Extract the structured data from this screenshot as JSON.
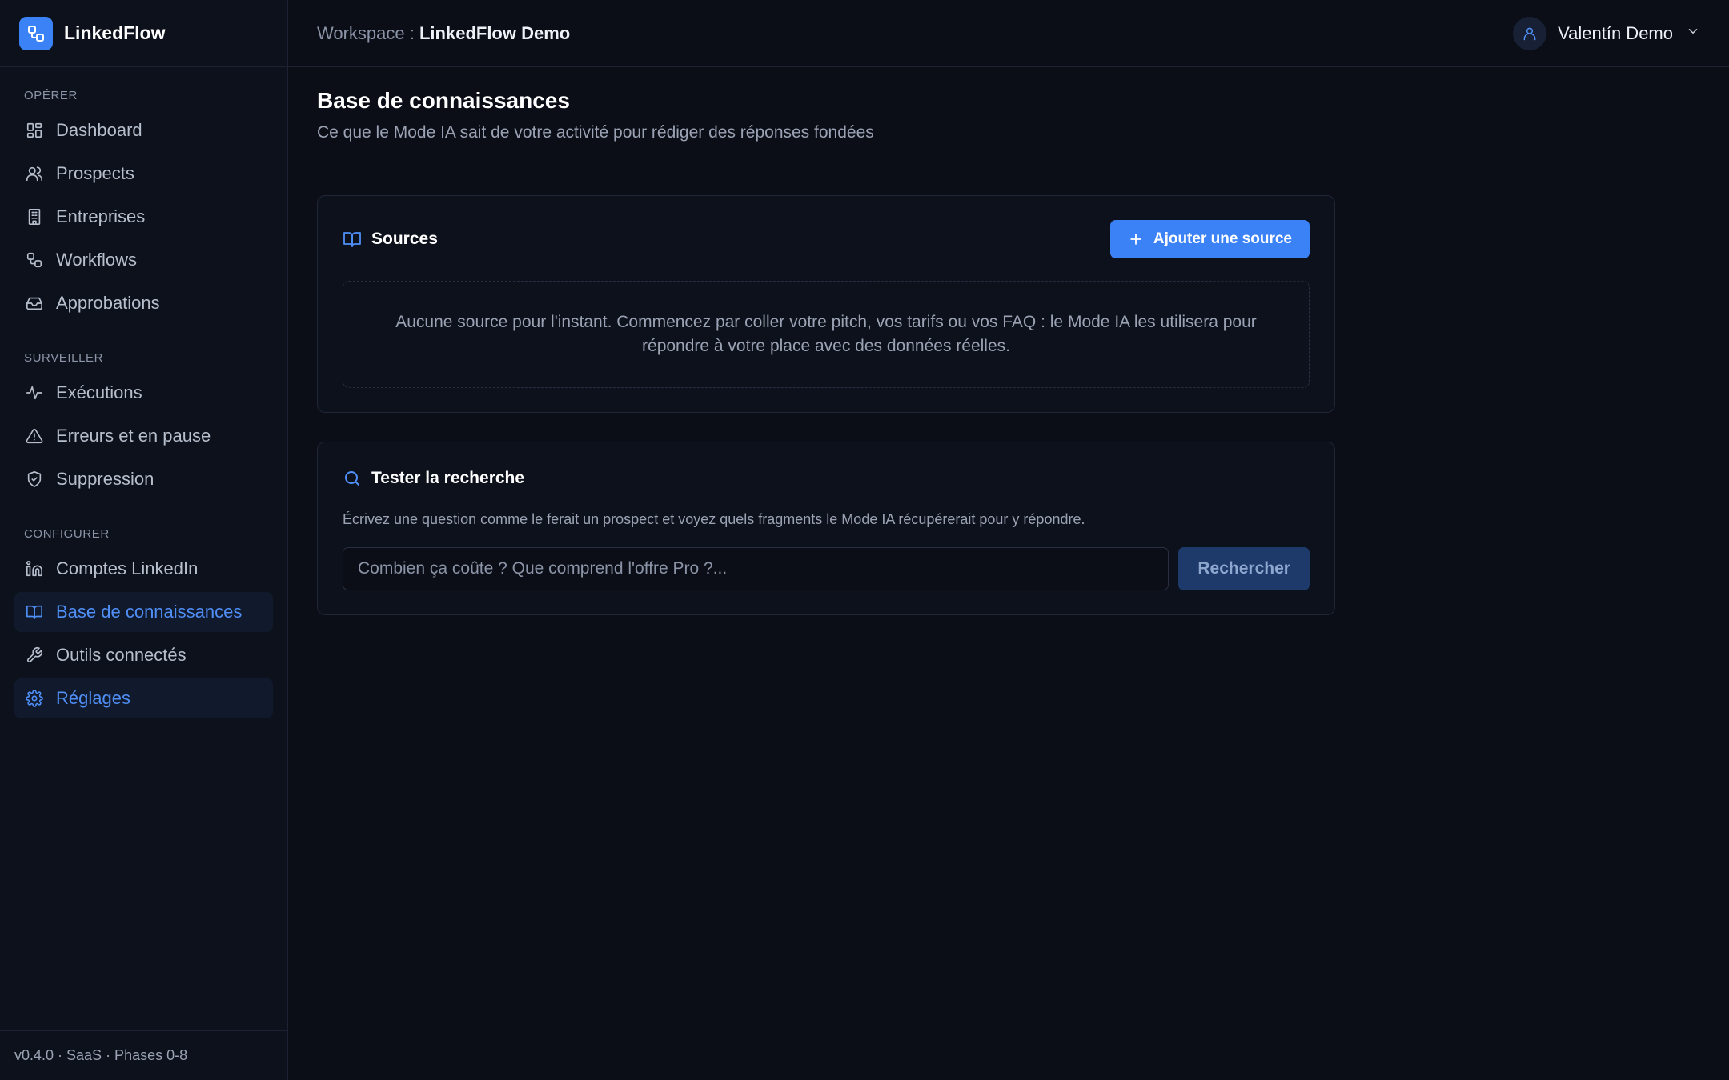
{
  "brand": {
    "name": "LinkedFlow",
    "icon": "workflow-icon",
    "accent": "#3b82f6"
  },
  "sidebar": {
    "sections": [
      {
        "title": "OPÉRER",
        "items": [
          {
            "label": "Dashboard",
            "icon": "dashboard-icon",
            "active": false
          },
          {
            "label": "Prospects",
            "icon": "users-icon",
            "active": false
          },
          {
            "label": "Entreprises",
            "icon": "building-icon",
            "active": false
          },
          {
            "label": "Workflows",
            "icon": "workflow-icon",
            "active": false
          },
          {
            "label": "Approbations",
            "icon": "inbox-icon",
            "active": false
          }
        ]
      },
      {
        "title": "SURVEILLER",
        "items": [
          {
            "label": "Exécutions",
            "icon": "activity-icon",
            "active": false
          },
          {
            "label": "Erreurs et en pause",
            "icon": "warning-icon",
            "active": false
          },
          {
            "label": "Suppression",
            "icon": "shield-icon",
            "active": false
          }
        ]
      },
      {
        "title": "CONFIGURER",
        "items": [
          {
            "label": "Comptes LinkedIn",
            "icon": "linkedin-icon",
            "active": false
          },
          {
            "label": "Base de connaissances",
            "icon": "book-icon",
            "active": true
          },
          {
            "label": "Outils connectés",
            "icon": "wrench-icon",
            "active": false
          },
          {
            "label": "Réglages",
            "icon": "gear-icon",
            "active": true
          }
        ]
      }
    ],
    "footer": "v0.4.0 · SaaS · Phases 0-8"
  },
  "topbar": {
    "workspace_label": "Workspace : ",
    "workspace_name": "LinkedFlow Demo",
    "user_name": "Valentín Demo"
  },
  "page": {
    "title": "Base de connaissances",
    "subtitle": "Ce que le Mode IA sait de votre activité pour rédiger des réponses fondées"
  },
  "sources": {
    "title": "Sources",
    "add_button": "Ajouter une source",
    "empty_text": "Aucune source pour l'instant. Commencez par coller votre pitch, vos tarifs ou vos FAQ : le Mode IA les utilisera pour répondre à votre place avec des données réelles."
  },
  "search": {
    "title": "Tester la recherche",
    "description": "Écrivez une question comme le ferait un prospect et voyez quels fragments le Mode IA récupérerait pour y répondre.",
    "placeholder": "Combien ça coûte ? Que comprend l'offre Pro ?...",
    "value": "",
    "button": "Rechercher"
  }
}
